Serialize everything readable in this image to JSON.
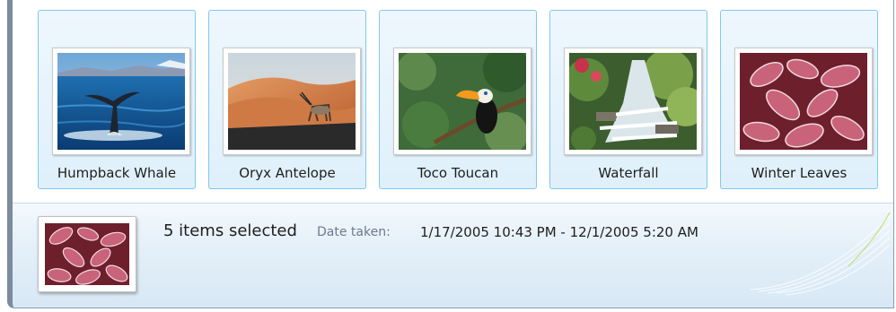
{
  "gallery": {
    "items": [
      {
        "label": "Humpback Whale",
        "image": "humpback-whale-photo"
      },
      {
        "label": "Oryx Antelope",
        "image": "oryx-antelope-photo"
      },
      {
        "label": "Toco Toucan",
        "image": "toco-toucan-photo"
      },
      {
        "label": "Waterfall",
        "image": "waterfall-photo"
      },
      {
        "label": "Winter Leaves",
        "image": "winter-leaves-photo"
      }
    ]
  },
  "details_pane": {
    "selection_text": "5 items selected",
    "date_label": "Date taken:",
    "date_value": "1/17/2005 10:43 PM - 12/1/2005 5:20 AM",
    "preview_image": "winter-leaves-photo"
  },
  "colors": {
    "tile_border": "#7fc8ee",
    "tile_fill": "#dff0fb",
    "details_gradient": "#d7e8f5",
    "window_frame": "#7c8b9d"
  }
}
